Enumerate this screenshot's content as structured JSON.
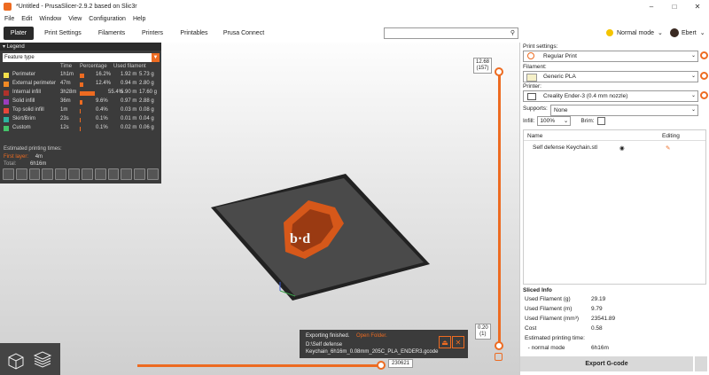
{
  "window": {
    "title": "*Untitled - PrusaSlicer-2.9.2 based on Slic3r"
  },
  "menu": [
    "File",
    "Edit",
    "Window",
    "View",
    "Configuration",
    "Help"
  ],
  "tabs": [
    "Plater",
    "Print Settings",
    "Filaments",
    "Printers",
    "Printables",
    "Prusa Connect"
  ],
  "mode": "Normal mode",
  "user": "Ebert",
  "legend": {
    "title": "Legend",
    "view_type": "Feature type",
    "columns": [
      "Time",
      "Percentage",
      "Used filament"
    ],
    "rows": [
      {
        "name": "Perimeter",
        "time": "1h1m",
        "pct": "16.2%",
        "pct_value": 16.2,
        "length": "1.92 m",
        "weight": "5.73 g",
        "color": "#f4e04a"
      },
      {
        "name": "External perimeter",
        "time": "47m",
        "pct": "12.4%",
        "pct_value": 12.4,
        "length": "0.94 m",
        "weight": "2.80 g",
        "color": "#f08a24"
      },
      {
        "name": "Internal infill",
        "time": "3h28m",
        "pct": "55.4%",
        "pct_value": 55.4,
        "length": "5.90 m",
        "weight": "17.60 g",
        "color": "#b0322b"
      },
      {
        "name": "Solid infill",
        "time": "36m",
        "pct": "9.6%",
        "pct_value": 9.6,
        "length": "0.97 m",
        "weight": "2.88 g",
        "color": "#9b3dbd"
      },
      {
        "name": "Top solid infill",
        "time": "1m",
        "pct": "0.4%",
        "pct_value": 0.4,
        "length": "0.03 m",
        "weight": "0.08 g",
        "color": "#e8453a"
      },
      {
        "name": "Skirt/Brim",
        "time": "23s",
        "pct": "0.1%",
        "pct_value": 0.1,
        "length": "0.01 m",
        "weight": "0.04 g",
        "color": "#2db39e"
      },
      {
        "name": "Custom",
        "time": "12s",
        "pct": "0.1%",
        "pct_value": 0.1,
        "length": "0.02 m",
        "weight": "0.06 g",
        "color": "#44c46a"
      }
    ],
    "estimated_label": "Estimated printing times:",
    "first_layer_label": "First layer:",
    "first_layer_value": "4m",
    "total_label": "Total:",
    "total_value": "6h16m"
  },
  "vertical_slider": {
    "top_label": "12.68\n(157)",
    "bottom_label": "0.20\n(1)"
  },
  "horizontal_slider": {
    "label": "230621"
  },
  "notification": {
    "line1": "Exporting finished.",
    "open_folder": "Open Folder.",
    "path": "D:\\Self defense Keychain_6h16m_0.08mm_205C_PLA_ENDER3.gcode"
  },
  "panel": {
    "print_settings_label": "Print settings:",
    "print_settings_value": "Regular Print",
    "filament_label": "Filament:",
    "filament_value": "Generic PLA",
    "printer_label": "Printer:",
    "printer_value": "Creality Ender-3 (0.4 mm nozzle)",
    "supports_label": "Supports:",
    "supports_value": "None",
    "infill_label": "Infill:",
    "infill_value": "100%",
    "brim_label": "Brim:",
    "list_name_header": "Name",
    "list_editing_header": "Editing",
    "object_name": "Self defense Keychain.stl",
    "sliced_title": "Sliced Info",
    "sliced": [
      {
        "k": "Used Filament (g)",
        "v": "29.19"
      },
      {
        "k": "Used Filament (m)",
        "v": "9.79"
      },
      {
        "k": "Used Filament (mm³)",
        "v": "23541.89"
      },
      {
        "k": "Cost",
        "v": "0.58"
      },
      {
        "k": "Estimated printing time:",
        "v": ""
      },
      {
        "k": "  - normal mode",
        "v": "6h16m"
      }
    ],
    "export_label": "Export G-code"
  },
  "colors": {
    "accent": "#ed6b21",
    "legend_bg": "#3b3b3b"
  }
}
